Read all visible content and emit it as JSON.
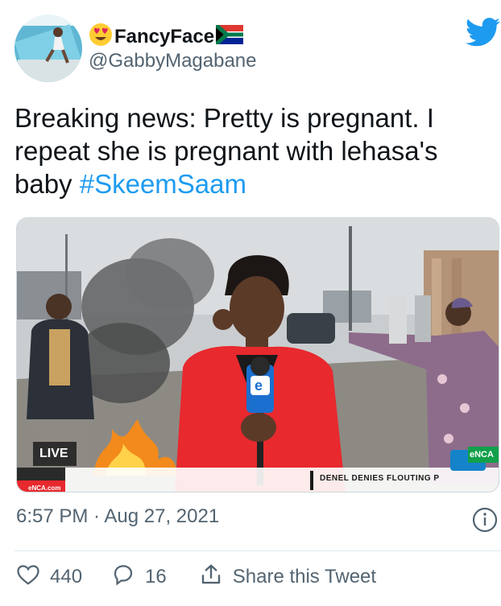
{
  "tweet": {
    "display_name": "FancyFace",
    "handle": "@GabbyMagabane",
    "name_emoji_icon": "heart-eyes-emoji-icon",
    "flag_icon": "south-africa-flag-icon",
    "platform_icon": "twitter-bird-icon",
    "text": "Breaking news: Pretty is pregnant. I repeat she is pregnant with lehasa's baby ",
    "hashtag": "#SkeemSaam",
    "timestamp": "6:57 PM · Aug 27, 2021",
    "likes": "440",
    "replies": "16",
    "share_label": "Share this Tweet"
  },
  "media": {
    "live_label": "LIVE",
    "channel_url": "eNCA.com",
    "channel_logo": "eNCA",
    "ticker": "DENEL DENIES FLOUTING P",
    "mic_label": "e"
  },
  "colors": {
    "accent": "#1d9bf0",
    "text": "#0f1419",
    "secondary": "#536471"
  }
}
